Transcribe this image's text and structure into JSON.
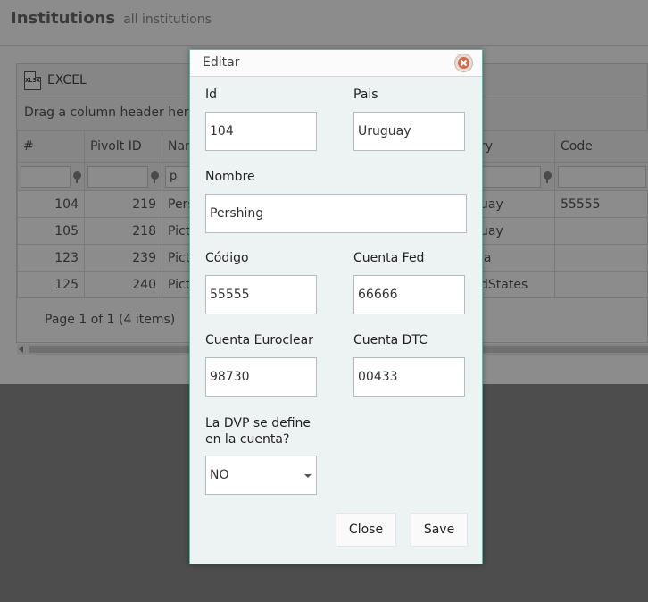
{
  "page": {
    "title": "Institutions",
    "subtitle": "all institutions"
  },
  "grid": {
    "excel_label": "EXCEL",
    "excel_icon_text": "XLSX",
    "group_hint": "Drag a column header here",
    "columns": [
      "#",
      "Pivolt ID",
      "Nar",
      "",
      "ry",
      "Code"
    ],
    "filters": [
      "",
      "",
      "p",
      "",
      "",
      ""
    ],
    "rows": [
      {
        "id": "104",
        "pivolt_id": "219",
        "name": "Pers",
        "country": "uay",
        "code": "55555"
      },
      {
        "id": "105",
        "pivolt_id": "218",
        "name": "Pict",
        "country": "uay",
        "code": ""
      },
      {
        "id": "123",
        "pivolt_id": "239",
        "name": "Pict",
        "country": "la",
        "code": ""
      },
      {
        "id": "125",
        "pivolt_id": "240",
        "name": "Pict",
        "country": "dStates",
        "code": ""
      }
    ],
    "pager": "Page 1 of 1 (4 items)"
  },
  "modal": {
    "title": "Editar",
    "fields": {
      "id": {
        "label": "Id",
        "value": "104"
      },
      "pais": {
        "label": "Pais",
        "value": "Uruguay"
      },
      "nombre": {
        "label": "Nombre",
        "value": "Pershing"
      },
      "codigo": {
        "label": "Código",
        "value": "55555"
      },
      "cuenta_fed": {
        "label": "Cuenta Fed",
        "value": "66666"
      },
      "cuenta_euroclear": {
        "label": "Cuenta Euroclear",
        "value": "98730"
      },
      "cuenta_dtc": {
        "label": "Cuenta DTC",
        "value": "00433"
      },
      "dvp": {
        "label": "La DVP se define en la cuenta?",
        "value": "NO"
      }
    },
    "close_label": "Close",
    "save_label": "Save"
  }
}
